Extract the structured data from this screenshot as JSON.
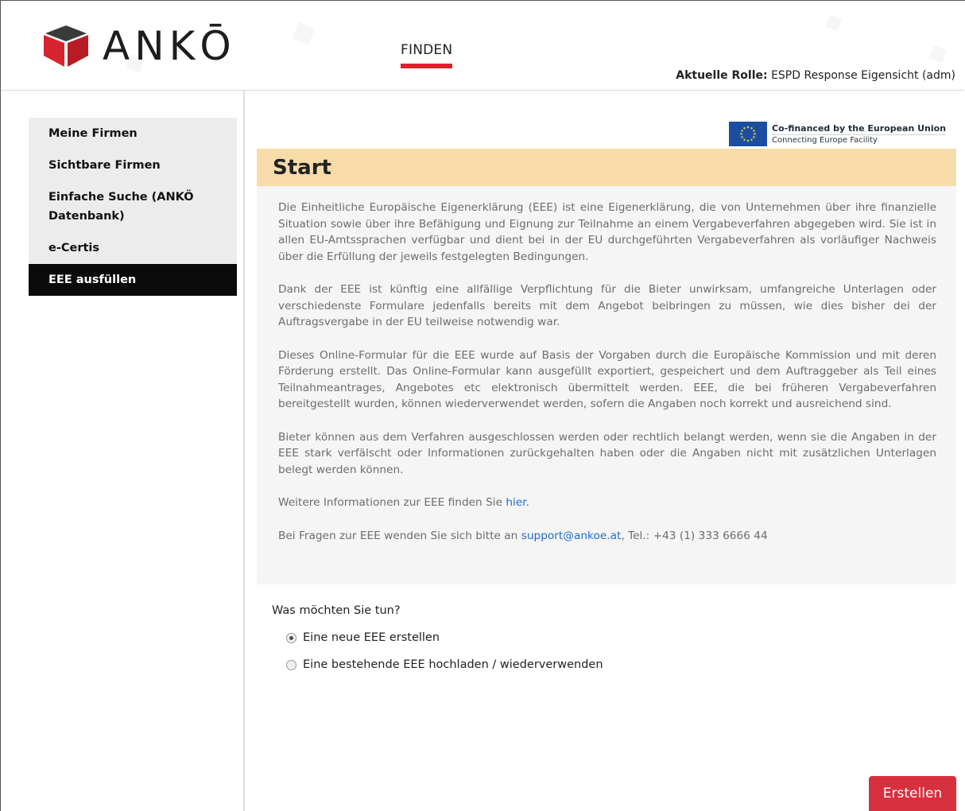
{
  "header": {
    "logo_text": "ANKŌ",
    "nav_finden": "FINDEN",
    "role_label": "Aktuelle Rolle:",
    "role_value": "ESPD Response Eigensicht (adm)",
    "accent_color": "#d7232d"
  },
  "sidebar": {
    "items": [
      {
        "label": "Meine Firmen",
        "active": false
      },
      {
        "label": "Sichtbare Firmen",
        "active": false
      },
      {
        "label": "Einfache Suche (ANKÖ Datenbank)",
        "active": false
      },
      {
        "label": "e-Certis",
        "active": false
      },
      {
        "label": "EEE ausfüllen",
        "active": true
      }
    ]
  },
  "eu_badge": {
    "line1": "Co-financed by the European Union",
    "line2": "Connecting Europe Facility"
  },
  "panel": {
    "title": "Start",
    "p1": "Die Einheitliche Europäische Eigenerklärung (EEE) ist eine Eigenerklärung, die von Unternehmen über ihre finanzielle Situation sowie über ihre Befähigung und Eignung zur Teilnahme an einem Vergabeverfahren abgegeben wird. Sie ist in allen EU-Amtssprachen verfügbar und dient bei in der EU durchgeführten Vergabeverfahren als vorläufiger Nachweis über die Erfüllung der jeweils festgelegten Bedingungen.",
    "p2": "Dank der EEE ist künftig eine allfällige Verpflichtung für die Bieter unwirksam, umfangreiche Unterlagen oder verschiedenste Formulare jedenfalls bereits mit dem Angebot beibringen zu müssen, wie dies bisher dei der Auftragsvergabe in der EU teilweise notwendig war.",
    "p3": "Dieses Online-Formular für die EEE wurde auf Basis der Vorgaben durch die Europäische Kommission und mit deren Förderung erstellt. Das Online-Formular kann ausgefüllt exportiert, gespeichert und dem Auftraggeber als Teil eines Teilnahmeantrages, Angebotes etc elektronisch übermittelt werden. EEE, die bei früheren Vergabeverfahren bereitgestellt wurden, können wiederverwendet werden, sofern die Angaben noch korrekt und ausreichend sind.",
    "p4": "Bieter können aus dem Verfahren ausgeschlossen werden oder rechtlich belangt werden, wenn sie die Angaben in der EEE stark verfälscht oder Informationen zurückgehalten haben oder die Angaben nicht mit zusätzlichen Unterlagen belegt werden können.",
    "p5_prefix": "Weitere Informationen zur EEE finden Sie ",
    "p5_link": "hier.",
    "p6_prefix": "Bei Fragen zur EEE wenden Sie sich bitte an ",
    "p6_link": "support@ankoe.at",
    "p6_suffix": ", Tel.: +43 (1) 333 6666 44"
  },
  "form": {
    "question": "Was möchten Sie tun?",
    "options": [
      {
        "label": "Eine neue EEE erstellen",
        "checked": true
      },
      {
        "label": "Eine bestehende EEE hochladen / wiederverwenden",
        "checked": false
      }
    ],
    "submit_label": "Erstellen"
  }
}
